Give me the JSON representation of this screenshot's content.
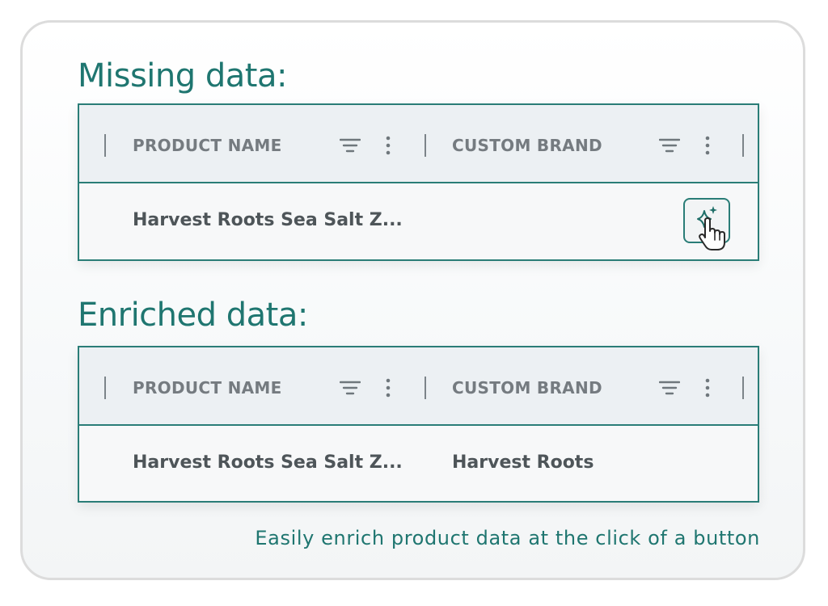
{
  "missing": {
    "title": "Missing data:",
    "columns": [
      "PRODUCT NAME",
      "CUSTOM BRAND"
    ],
    "row": {
      "product_name": "Harvest Roots Sea Salt Z...",
      "custom_brand": ""
    },
    "enrich_button_icon": "sparkle-icon",
    "cursor_icon": "hand-pointer-icon"
  },
  "enriched": {
    "title": "Enriched data:",
    "columns": [
      "PRODUCT NAME",
      "CUSTOM BRAND"
    ],
    "row": {
      "product_name": "Harvest Roots Sea Salt Z...",
      "custom_brand": "Harvest Roots"
    }
  },
  "column_icons": [
    "filter-icon",
    "more-vertical-icon"
  ],
  "caption": "Easily enrich product data at the click of a button",
  "colors": {
    "accent": "#1f7670",
    "border": "#2a7d77",
    "header_bg": "#ecf0f3",
    "header_text": "#757b80",
    "cell_text": "#4e5559"
  }
}
